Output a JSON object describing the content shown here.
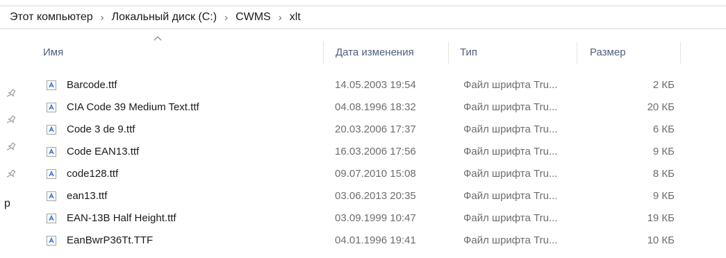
{
  "breadcrumb": {
    "items": [
      "Этот компьютер",
      "Локальный диск (C:)",
      "CWMS",
      "xlt"
    ],
    "separator": "›"
  },
  "columns": {
    "name": "Имя",
    "date": "Дата изменения",
    "type": "Тип",
    "size": "Размер"
  },
  "files": [
    {
      "name": "Barcode.ttf",
      "date": "14.05.2003 19:54",
      "type": "Файл шрифта Tru...",
      "size": "2 КБ"
    },
    {
      "name": "CIA Code 39 Medium Text.ttf",
      "date": "04.08.1996 18:32",
      "type": "Файл шрифта Tru...",
      "size": "20 КБ"
    },
    {
      "name": "Code 3 de 9.ttf",
      "date": "20.03.2006 17:37",
      "type": "Файл шрифта Tru...",
      "size": "6 КБ"
    },
    {
      "name": "Code EAN13.ttf",
      "date": "16.03.2006 17:56",
      "type": "Файл шрифта Tru...",
      "size": "9 КБ"
    },
    {
      "name": "code128.ttf",
      "date": "09.07.2010 15:08",
      "type": "Файл шрифта Tru...",
      "size": "8 КБ"
    },
    {
      "name": "ean13.ttf",
      "date": "03.06.2013 20:35",
      "type": "Файл шрифта Tru...",
      "size": "9 КБ"
    },
    {
      "name": "EAN-13B Half Height.ttf",
      "date": "03.09.1999 10:47",
      "type": "Файл шрифта Tru...",
      "size": "19 КБ"
    },
    {
      "name": "EanBwrP36Tt.TTF",
      "date": "04.01.1996 19:41",
      "type": "Файл шрифта Tru...",
      "size": "10 КБ"
    }
  ],
  "sidebar": {
    "partial_letter": "p",
    "pin_icon": "pin-icon"
  },
  "icons": {
    "file": "truetype-font-file-icon",
    "sort": "sort-ascending-icon"
  },
  "colors": {
    "header_text": "#4c607a",
    "secondary_text": "#6d6d6d",
    "font_icon_blue": "#2f6fd0"
  }
}
